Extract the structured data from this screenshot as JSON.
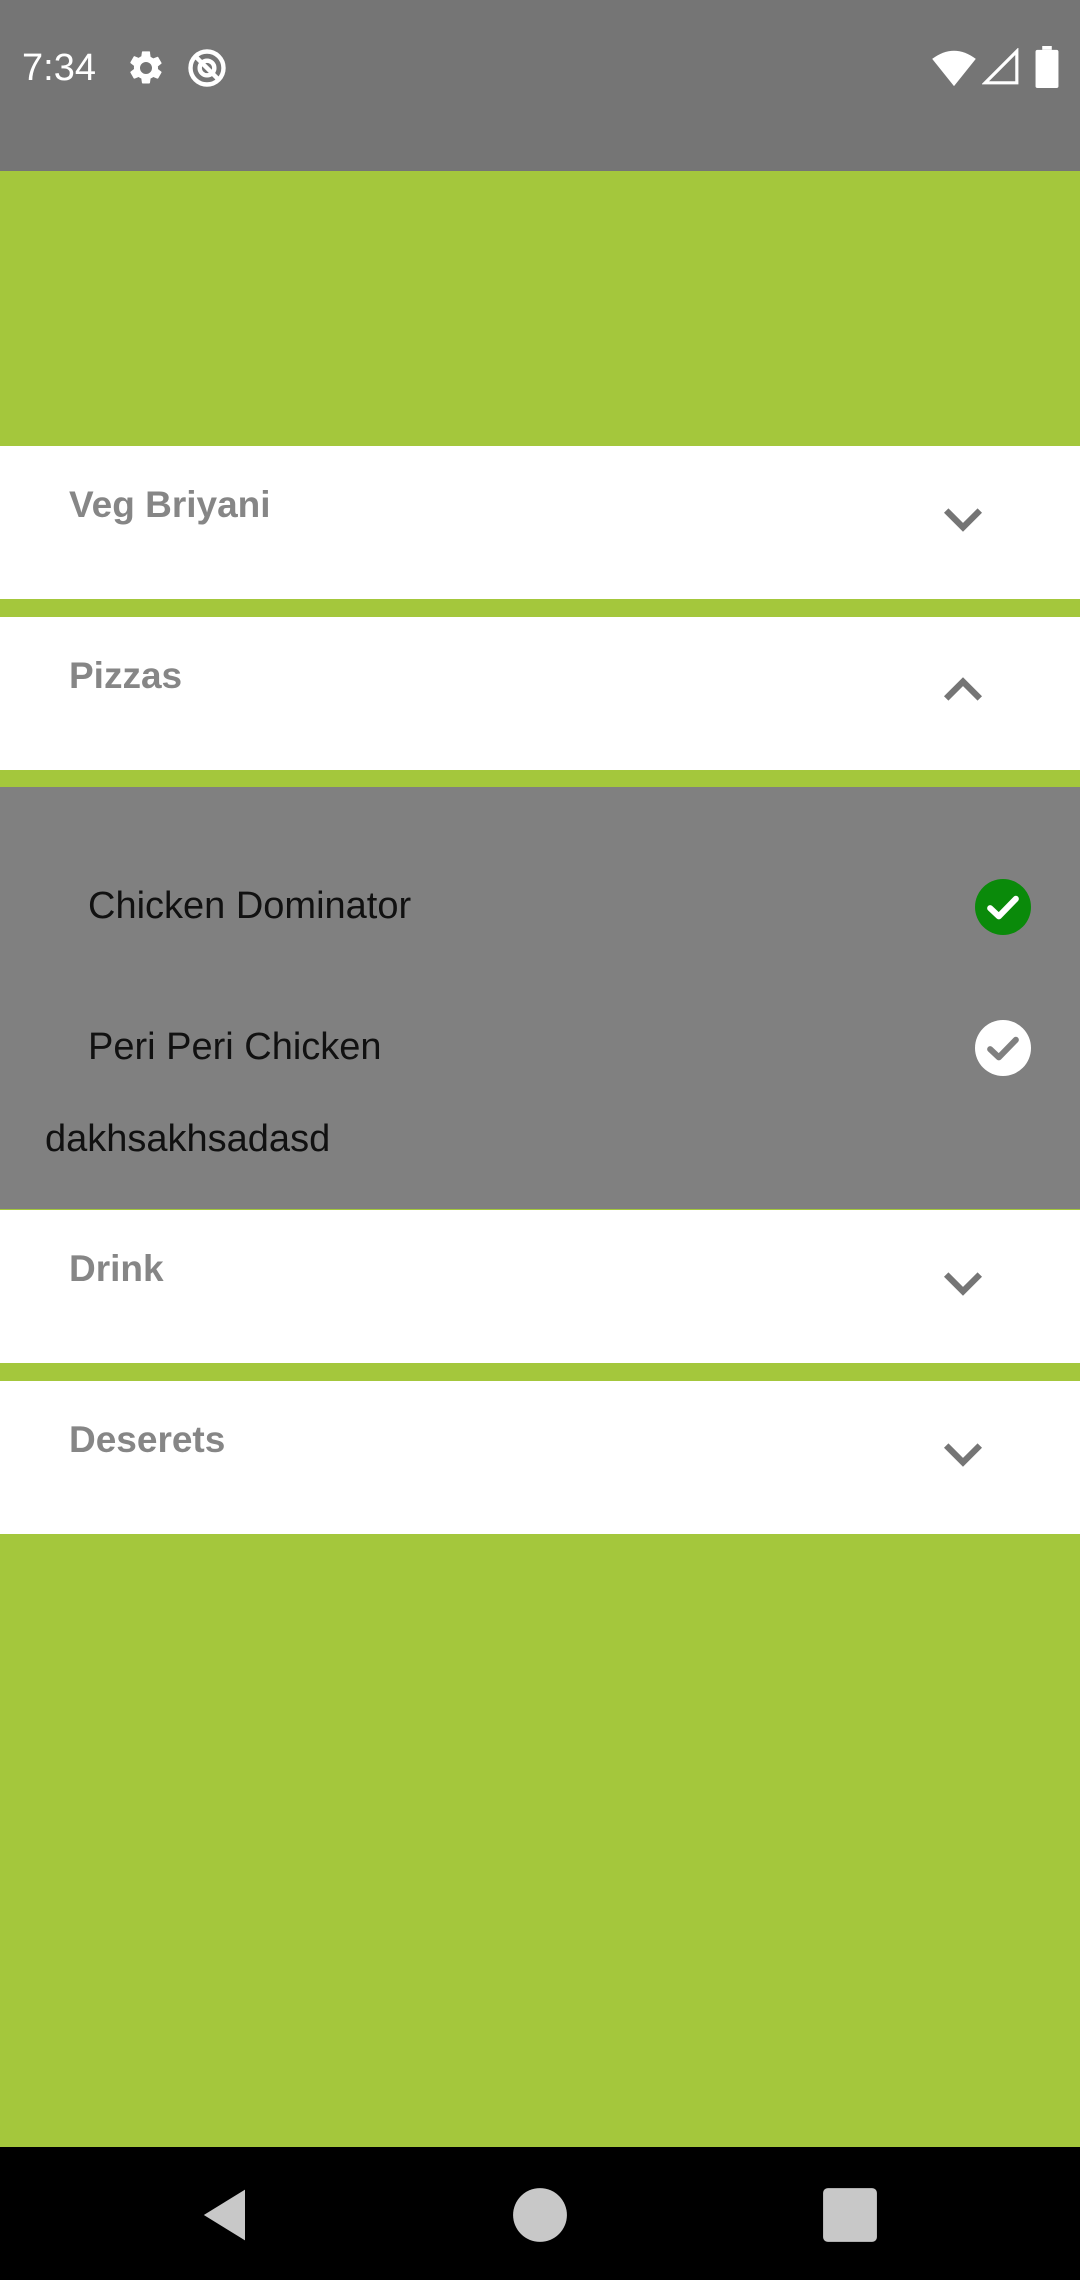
{
  "status_bar": {
    "time": "7:34",
    "icons_left": [
      "gear-icon",
      "no-sync-icon"
    ],
    "icons_right": [
      "wifi-icon",
      "signal-icon",
      "battery-icon"
    ]
  },
  "sections": [
    {
      "title": "Veg Briyani",
      "expanded": false
    },
    {
      "title": "Pizzas",
      "expanded": true
    },
    {
      "title": "Drink",
      "expanded": false
    },
    {
      "title": "Deserets",
      "expanded": false
    }
  ],
  "pizzas_items": [
    {
      "label": "Chicken Dominator",
      "checked": true
    },
    {
      "label": "Peri Peri Chicken",
      "checked": false
    }
  ],
  "pizzas_extra_text": "dakhsakhsadasd",
  "nav_bar": {
    "buttons": [
      "back-icon",
      "home-icon",
      "recents-icon"
    ]
  },
  "colors": {
    "accent": "#a4c73c",
    "status_bar": "#757575",
    "expanded_bg": "#808080",
    "check_green": "#0a8a0a"
  }
}
